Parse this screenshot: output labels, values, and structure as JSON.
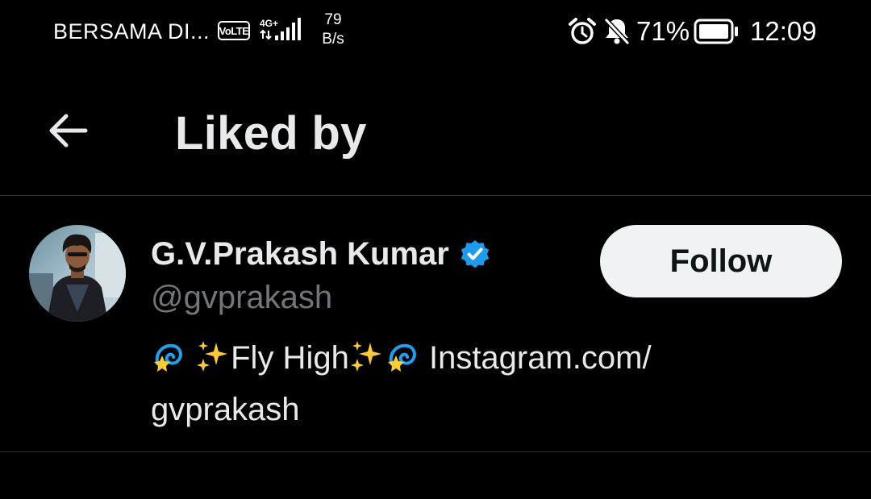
{
  "status_bar": {
    "carrier": "BERSAMA DI...",
    "volte": "VoLTE",
    "network_type": "4G+",
    "speed_value": "79",
    "speed_unit": "B/s",
    "battery_percent": "71%",
    "time": "12:09",
    "icons": [
      "volte-icon",
      "signal-icon",
      "alarm-icon",
      "mute-icon",
      "battery-icon"
    ]
  },
  "header": {
    "title": "Liked by",
    "back_icon": "arrow-left-icon"
  },
  "user": {
    "display_name": "G.V.Prakash Kumar",
    "handle": "@gvprakash",
    "verified": true,
    "verified_color": "#1d9bf0",
    "follow_label": "Follow",
    "bio_line1_text_a": "Fly High",
    "bio_line1_text_b": "Instagram.com/",
    "bio_line2": "gvprakash"
  },
  "colors": {
    "background": "#000000",
    "primary_text": "#e7e9ea",
    "secondary_text": "#71767b",
    "divider": "#2f3336",
    "button_bg": "#eff3f4",
    "button_text": "#0f1419"
  }
}
